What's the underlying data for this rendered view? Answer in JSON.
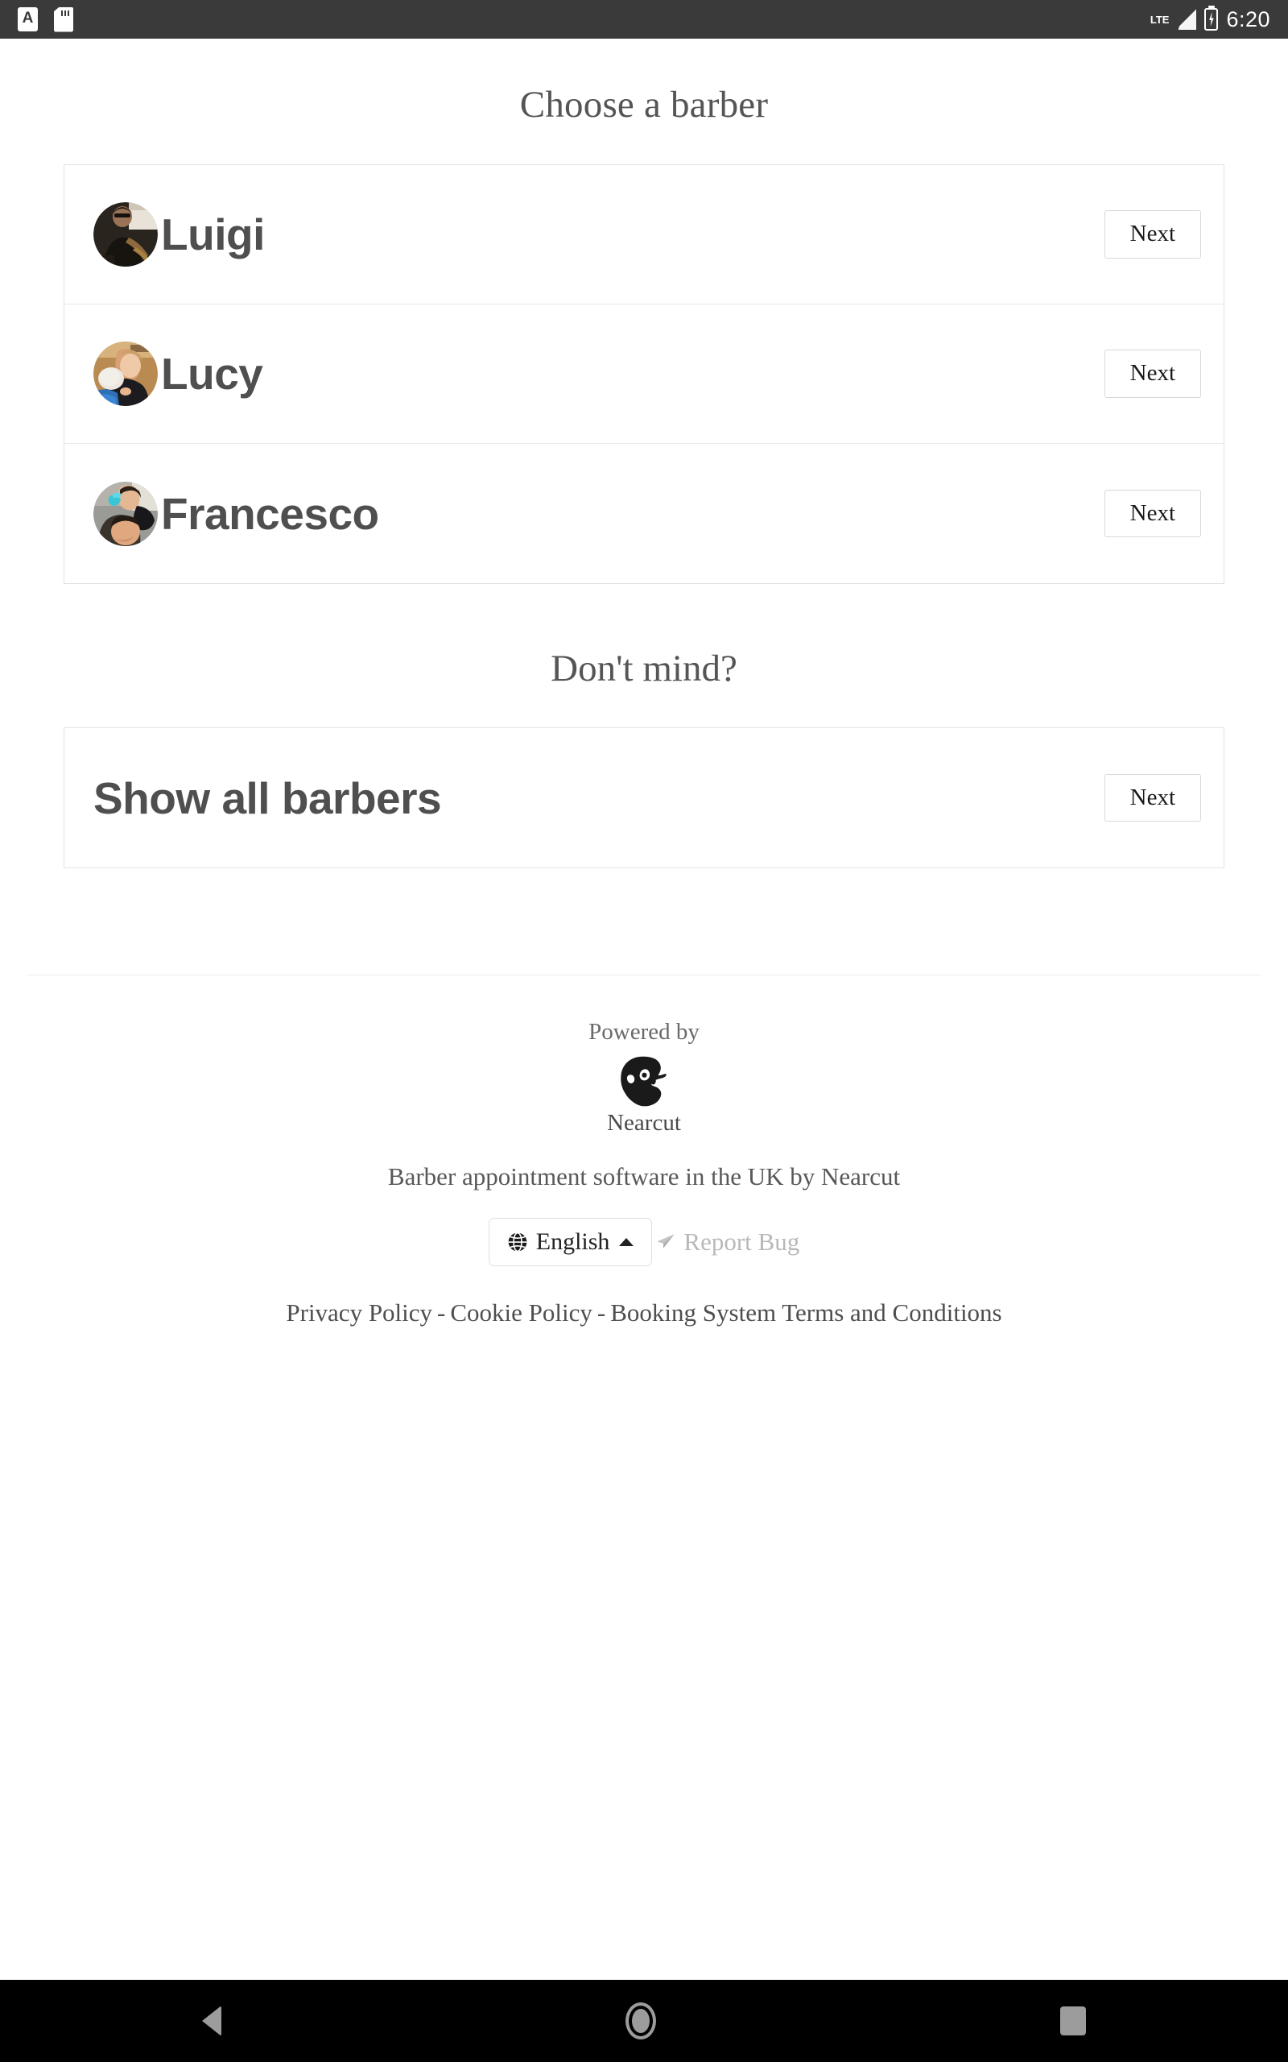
{
  "status_bar": {
    "left_icons": [
      "app-notification-a-icon",
      "sdcard-icon"
    ],
    "network": "LTE",
    "time": "6:20"
  },
  "page": {
    "title": "Choose a barber",
    "section_title": "Don't mind?"
  },
  "barbers": [
    {
      "name": "Luigi",
      "next_label": "Next"
    },
    {
      "name": "Lucy",
      "next_label": "Next"
    },
    {
      "name": "Francesco",
      "next_label": "Next"
    }
  ],
  "show_all": {
    "label": "Show all barbers",
    "next_label": "Next"
  },
  "footer": {
    "powered_by": "Powered by",
    "brand": "Nearcut",
    "tagline": "Barber appointment software in the UK by Nearcut",
    "language": "English",
    "report_bug": "Report Bug",
    "legal": [
      "Privacy Policy",
      "Cookie Policy",
      "Booking System Terms and Conditions"
    ],
    "legal_separator": "-"
  },
  "nav_bar": {
    "back": "back-icon",
    "home": "home-icon",
    "recents": "recents-icon"
  },
  "colors": {
    "status_bar_bg": "#3a3a3a",
    "nav_bar_bg": "#000000",
    "heading": "#555555",
    "name": "#4f4f4f",
    "border": "#e2e2e2",
    "muted": "#b8b8b8"
  }
}
